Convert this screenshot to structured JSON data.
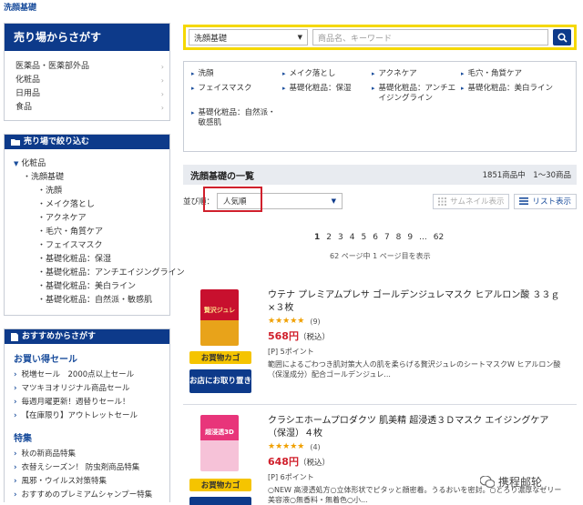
{
  "page": {
    "title": "洗顔基礎"
  },
  "left": {
    "store_box": {
      "title": "売り場からさがす",
      "items": [
        "医薬品・医薬部外品",
        "化粧品",
        "日用品",
        "食品"
      ]
    },
    "filter_box": {
      "title": "売り場で絞り込む",
      "level1": "化粧品",
      "level2": "洗顔基礎",
      "level3": [
        "洗顔",
        "メイク落とし",
        "アクネケア",
        "毛穴・角質ケア",
        "フェイスマスク",
        "基礎化粧品：保湿",
        "基礎化粧品：アンチエイジングライン",
        "基礎化粧品：美白ライン",
        "基礎化粧品：自然派・敏感肌"
      ]
    },
    "recommend_box": {
      "title": "おすすめからさがす",
      "sale_title": "お買い得セール",
      "sale_items": [
        "税増セール　2000点以上セール",
        "マツキヨオリジナル商品セール",
        "毎週月曜更新！週替りセール！",
        "【在庫限り】アウトレットセール"
      ],
      "feature_title": "特集",
      "feature_items": [
        "秋の新商品特集",
        "衣替えシーズン！ 防虫剤商品特集",
        "風邪・ウイルス対策特集",
        "おすすめのプレミアムシャンプー特集"
      ]
    }
  },
  "search": {
    "category_value": "洗顔基礎",
    "placeholder": "商品名、キーワード"
  },
  "subcategories": [
    "洗顔",
    "メイク落とし",
    "アクネケア",
    "毛穴・角質ケア",
    "フェイスマスク",
    "基礎化粧品：保湿",
    "基礎化粧品：アンチエイジングライン",
    "基礎化粧品：美白ライン",
    "基礎化粧品：自然派・敏感肌"
  ],
  "listing": {
    "title": "洗顔基礎の一覧",
    "count": "1851商品中　1〜30商品",
    "sort_label": "並び順：",
    "sort_value": "人気順",
    "view_thumb": "サムネイル表示",
    "view_list": "リスト表示",
    "pages": [
      "1",
      "2",
      "3",
      "4",
      "5",
      "6",
      "7",
      "8",
      "9",
      "...",
      "62"
    ],
    "page_info": "62 ページ中 1 ページ目を表示"
  },
  "products": [
    {
      "name": "ウテナ プレミアムプレサ ゴールデンジュレマスク ヒアルロン酸 ３３ｇ×３枚",
      "stars": "★★★★★",
      "reviews": "(9)",
      "price": "568円",
      "tax": "（税込）",
      "points": "[P]  5ポイント",
      "desc": "範囲によるごわつき肌対策大人の肌を柔らげる贅沢ジュレのシートマスクW ヒアルロン酸（保湿成分）配合ゴールデンジュレ...",
      "cart_label": "お買物カゴ",
      "store_label": "お店にお取り置き",
      "image_text": "贅沢ジュレ",
      "colors": {
        "top": "#c8102e",
        "bottom": "#e8a31a"
      }
    },
    {
      "name": "クラシエホームプロダクツ 肌美精 超浸透３Ｄマスク エイジングケア（保湿）４枚",
      "stars": "★★★★★",
      "reviews": "(4)",
      "price": "648円",
      "tax": "（税込）",
      "points": "[P]  6ポイント",
      "desc": "○NEW 高浸透処方○立体形状でピタッと顔密着。うるおいを密封。○とろり濃厚なゼリー美容液○無香料・無着色○小...",
      "cart_label": "お買物カゴ",
      "store_label": "お店にお取り置き",
      "image_text": "超浸透3D",
      "colors": {
        "top": "#e8357a",
        "bottom": "#f6c2d8"
      }
    }
  ],
  "watermark": "携程邮轮",
  "colors": {
    "brand_navy": "#0d3a8a",
    "search_yellow": "#f5d800",
    "sale_red": "#d0202c",
    "cart_yellow": "#f5c400"
  }
}
